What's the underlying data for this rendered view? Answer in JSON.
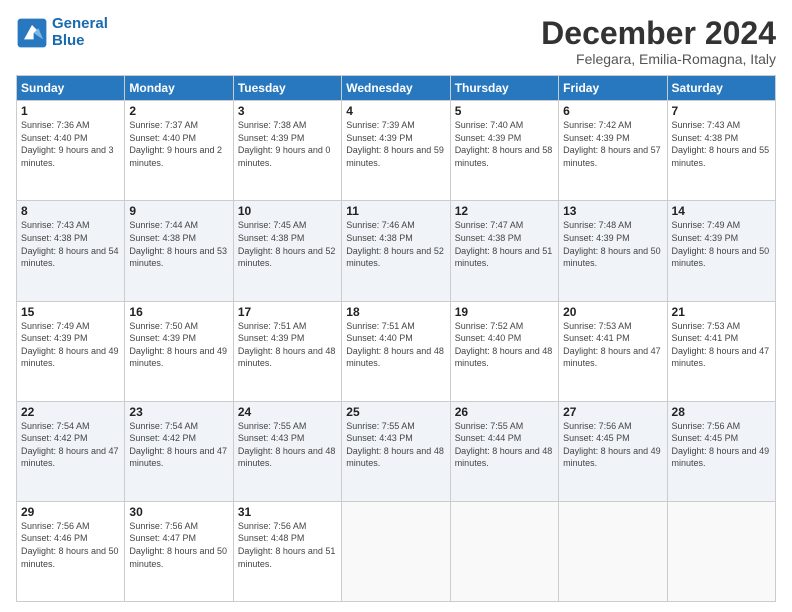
{
  "logo": {
    "line1": "General",
    "line2": "Blue"
  },
  "title": "December 2024",
  "subtitle": "Felegara, Emilia-Romagna, Italy",
  "headers": [
    "Sunday",
    "Monday",
    "Tuesday",
    "Wednesday",
    "Thursday",
    "Friday",
    "Saturday"
  ],
  "weeks": [
    [
      {
        "day": "1",
        "sunrise": "Sunrise: 7:36 AM",
        "sunset": "Sunset: 4:40 PM",
        "daylight": "Daylight: 9 hours and 3 minutes."
      },
      {
        "day": "2",
        "sunrise": "Sunrise: 7:37 AM",
        "sunset": "Sunset: 4:40 PM",
        "daylight": "Daylight: 9 hours and 2 minutes."
      },
      {
        "day": "3",
        "sunrise": "Sunrise: 7:38 AM",
        "sunset": "Sunset: 4:39 PM",
        "daylight": "Daylight: 9 hours and 0 minutes."
      },
      {
        "day": "4",
        "sunrise": "Sunrise: 7:39 AM",
        "sunset": "Sunset: 4:39 PM",
        "daylight": "Daylight: 8 hours and 59 minutes."
      },
      {
        "day": "5",
        "sunrise": "Sunrise: 7:40 AM",
        "sunset": "Sunset: 4:39 PM",
        "daylight": "Daylight: 8 hours and 58 minutes."
      },
      {
        "day": "6",
        "sunrise": "Sunrise: 7:42 AM",
        "sunset": "Sunset: 4:39 PM",
        "daylight": "Daylight: 8 hours and 57 minutes."
      },
      {
        "day": "7",
        "sunrise": "Sunrise: 7:43 AM",
        "sunset": "Sunset: 4:38 PM",
        "daylight": "Daylight: 8 hours and 55 minutes."
      }
    ],
    [
      {
        "day": "8",
        "sunrise": "Sunrise: 7:43 AM",
        "sunset": "Sunset: 4:38 PM",
        "daylight": "Daylight: 8 hours and 54 minutes."
      },
      {
        "day": "9",
        "sunrise": "Sunrise: 7:44 AM",
        "sunset": "Sunset: 4:38 PM",
        "daylight": "Daylight: 8 hours and 53 minutes."
      },
      {
        "day": "10",
        "sunrise": "Sunrise: 7:45 AM",
        "sunset": "Sunset: 4:38 PM",
        "daylight": "Daylight: 8 hours and 52 minutes."
      },
      {
        "day": "11",
        "sunrise": "Sunrise: 7:46 AM",
        "sunset": "Sunset: 4:38 PM",
        "daylight": "Daylight: 8 hours and 52 minutes."
      },
      {
        "day": "12",
        "sunrise": "Sunrise: 7:47 AM",
        "sunset": "Sunset: 4:38 PM",
        "daylight": "Daylight: 8 hours and 51 minutes."
      },
      {
        "day": "13",
        "sunrise": "Sunrise: 7:48 AM",
        "sunset": "Sunset: 4:39 PM",
        "daylight": "Daylight: 8 hours and 50 minutes."
      },
      {
        "day": "14",
        "sunrise": "Sunrise: 7:49 AM",
        "sunset": "Sunset: 4:39 PM",
        "daylight": "Daylight: 8 hours and 50 minutes."
      }
    ],
    [
      {
        "day": "15",
        "sunrise": "Sunrise: 7:49 AM",
        "sunset": "Sunset: 4:39 PM",
        "daylight": "Daylight: 8 hours and 49 minutes."
      },
      {
        "day": "16",
        "sunrise": "Sunrise: 7:50 AM",
        "sunset": "Sunset: 4:39 PM",
        "daylight": "Daylight: 8 hours and 49 minutes."
      },
      {
        "day": "17",
        "sunrise": "Sunrise: 7:51 AM",
        "sunset": "Sunset: 4:39 PM",
        "daylight": "Daylight: 8 hours and 48 minutes."
      },
      {
        "day": "18",
        "sunrise": "Sunrise: 7:51 AM",
        "sunset": "Sunset: 4:40 PM",
        "daylight": "Daylight: 8 hours and 48 minutes."
      },
      {
        "day": "19",
        "sunrise": "Sunrise: 7:52 AM",
        "sunset": "Sunset: 4:40 PM",
        "daylight": "Daylight: 8 hours and 48 minutes."
      },
      {
        "day": "20",
        "sunrise": "Sunrise: 7:53 AM",
        "sunset": "Sunset: 4:41 PM",
        "daylight": "Daylight: 8 hours and 47 minutes."
      },
      {
        "day": "21",
        "sunrise": "Sunrise: 7:53 AM",
        "sunset": "Sunset: 4:41 PM",
        "daylight": "Daylight: 8 hours and 47 minutes."
      }
    ],
    [
      {
        "day": "22",
        "sunrise": "Sunrise: 7:54 AM",
        "sunset": "Sunset: 4:42 PM",
        "daylight": "Daylight: 8 hours and 47 minutes."
      },
      {
        "day": "23",
        "sunrise": "Sunrise: 7:54 AM",
        "sunset": "Sunset: 4:42 PM",
        "daylight": "Daylight: 8 hours and 47 minutes."
      },
      {
        "day": "24",
        "sunrise": "Sunrise: 7:55 AM",
        "sunset": "Sunset: 4:43 PM",
        "daylight": "Daylight: 8 hours and 48 minutes."
      },
      {
        "day": "25",
        "sunrise": "Sunrise: 7:55 AM",
        "sunset": "Sunset: 4:43 PM",
        "daylight": "Daylight: 8 hours and 48 minutes."
      },
      {
        "day": "26",
        "sunrise": "Sunrise: 7:55 AM",
        "sunset": "Sunset: 4:44 PM",
        "daylight": "Daylight: 8 hours and 48 minutes."
      },
      {
        "day": "27",
        "sunrise": "Sunrise: 7:56 AM",
        "sunset": "Sunset: 4:45 PM",
        "daylight": "Daylight: 8 hours and 49 minutes."
      },
      {
        "day": "28",
        "sunrise": "Sunrise: 7:56 AM",
        "sunset": "Sunset: 4:45 PM",
        "daylight": "Daylight: 8 hours and 49 minutes."
      }
    ],
    [
      {
        "day": "29",
        "sunrise": "Sunrise: 7:56 AM",
        "sunset": "Sunset: 4:46 PM",
        "daylight": "Daylight: 8 hours and 50 minutes."
      },
      {
        "day": "30",
        "sunrise": "Sunrise: 7:56 AM",
        "sunset": "Sunset: 4:47 PM",
        "daylight": "Daylight: 8 hours and 50 minutes."
      },
      {
        "day": "31",
        "sunrise": "Sunrise: 7:56 AM",
        "sunset": "Sunset: 4:48 PM",
        "daylight": "Daylight: 8 hours and 51 minutes."
      },
      null,
      null,
      null,
      null
    ]
  ]
}
